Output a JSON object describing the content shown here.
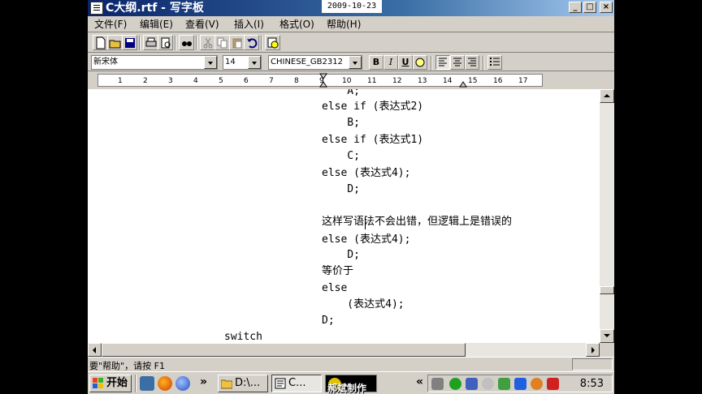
{
  "window": {
    "title": "C大纲.rtf - 写字板",
    "date_overlay": "2009-10-23",
    "controls": [
      "_",
      "□",
      "×"
    ]
  },
  "menu": [
    "文件(F)",
    "编辑(E)",
    "查看(V)",
    "插入(I)",
    "格式(O)",
    "帮助(H)"
  ],
  "toolbar": {
    "icons": [
      "new-icon",
      "open-icon",
      "save-icon",
      "print-icon",
      "print-preview-icon",
      "find-icon",
      "cut-icon",
      "copy-icon",
      "paste-icon",
      "undo-icon",
      "insert-datetime-icon"
    ]
  },
  "format_bar": {
    "font": "新宋体",
    "size": "14",
    "script": "CHINESE_GB2312",
    "bold": "B",
    "italic": "I",
    "underline": "U"
  },
  "ruler": {
    "labels": [
      "1",
      "2",
      "3",
      "4",
      "5",
      "6",
      "7",
      "8",
      "9",
      "10",
      "11",
      "12",
      "13",
      "14",
      "15",
      "16",
      "17"
    ]
  },
  "document": {
    "lines": [
      "    A;",
      "else if (表达式2)",
      "    B;",
      "else if (表达式1)",
      "    C;",
      "else (表达式4);",
      "    D;",
      "",
      "这样写语法不会出错，但逻辑上是错误的",
      "else (表达式4);",
      "    D;",
      "等价于",
      "else",
      "    (表达式4);",
      "D;"
    ],
    "bottom_line": "switch"
  },
  "status": {
    "help_text": "要\"帮助\"，请按 F1"
  },
  "taskbar": {
    "start_label": "开始",
    "more": "»",
    "tasks": [
      "D:\\...",
      "C..."
    ],
    "tray_more": "«",
    "clock": "8:53"
  },
  "watermark": "郝斌制作"
}
